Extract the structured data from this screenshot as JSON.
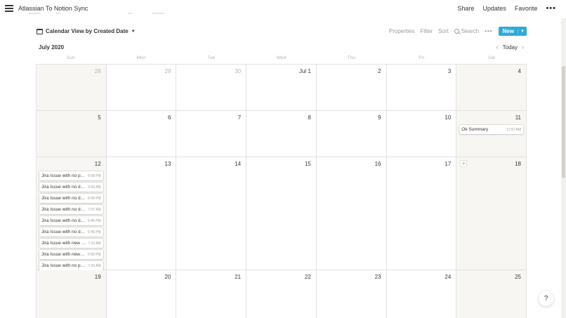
{
  "topbar": {
    "title": "Atlassian To Notion Sync",
    "share": "Share",
    "updates": "Updates",
    "favorite": "Favorite",
    "more": "•••"
  },
  "toolbar": {
    "view_title": "Calendar View by Created Date",
    "properties": "Properties",
    "filter": "Filter",
    "sort": "Sort",
    "search": "Search",
    "more": "•••",
    "new": "New",
    "accent_color": "#2eaadc"
  },
  "calendar": {
    "month": "July 2020",
    "today": "Today",
    "weekdays": [
      "Sun",
      "Mon",
      "Tue",
      "Wed",
      "Thu",
      "Fri",
      "Sat"
    ],
    "weeks": [
      {
        "days": [
          {
            "label": "28",
            "dim": true,
            "events": []
          },
          {
            "label": "29",
            "dim": true,
            "events": []
          },
          {
            "label": "30",
            "dim": true,
            "events": []
          },
          {
            "label": "Jul 1",
            "dim": false,
            "events": []
          },
          {
            "label": "2",
            "dim": false,
            "events": []
          },
          {
            "label": "3",
            "dim": false,
            "events": []
          },
          {
            "label": "4",
            "dim": false,
            "events": []
          }
        ]
      },
      {
        "days": [
          {
            "label": "5",
            "dim": false,
            "events": []
          },
          {
            "label": "6",
            "dim": false,
            "events": []
          },
          {
            "label": "7",
            "dim": false,
            "events": []
          },
          {
            "label": "8",
            "dim": false,
            "events": []
          },
          {
            "label": "9",
            "dim": false,
            "events": []
          },
          {
            "label": "10",
            "dim": false,
            "events": []
          },
          {
            "label": "11",
            "dim": false,
            "events": [
              {
                "title": "Ok Summary",
                "time": "11:57 AM"
              }
            ]
          }
        ]
      },
      {
        "days": [
          {
            "label": "12",
            "dim": false,
            "events": [
              {
                "title": "Jira Issue with no pri...",
                "time": "6:58 PM"
              },
              {
                "title": "Jira Issue with no de...",
                "time": "6:59 AM"
              },
              {
                "title": "Jira Issue with no de...",
                "time": "6:49 PM"
              },
              {
                "title": "Jira Issue with no de...",
                "time": "7:07 AM"
              },
              {
                "title": "Jira Issue with no de...",
                "time": "6:46 PM"
              },
              {
                "title": "Jira Issue with no de...",
                "time": "6:45 PM"
              },
              {
                "title": "Jira Issue with new r...",
                "time": "7:19 AM"
              },
              {
                "title": "Jira Issue with new r...",
                "time": "6:56 PM"
              },
              {
                "title": "Jira Issue with no pri...",
                "time": "7:19 AM"
              }
            ]
          },
          {
            "label": "13",
            "dim": false,
            "events": []
          },
          {
            "label": "14",
            "dim": false,
            "events": []
          },
          {
            "label": "15",
            "dim": false,
            "events": []
          },
          {
            "label": "16",
            "dim": false,
            "events": []
          },
          {
            "label": "17",
            "dim": false,
            "events": []
          },
          {
            "label": "18",
            "dim": false,
            "add_button": "+",
            "events": []
          }
        ]
      },
      {
        "days": [
          {
            "label": "19",
            "dim": false,
            "events": []
          },
          {
            "label": "20",
            "dim": false,
            "events": []
          },
          {
            "label": "21",
            "dim": false,
            "events": []
          },
          {
            "label": "22",
            "dim": false,
            "events": []
          },
          {
            "label": "23",
            "dim": false,
            "events": []
          },
          {
            "label": "24",
            "dim": false,
            "events": []
          },
          {
            "label": "25",
            "dim": false,
            "events": []
          }
        ]
      }
    ]
  },
  "help": {
    "label": "?"
  }
}
